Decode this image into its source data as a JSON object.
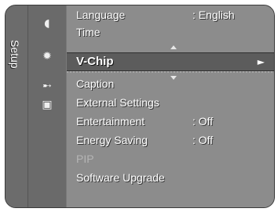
{
  "tab": {
    "label": "Setup"
  },
  "icons": [
    {
      "name": "picture-icon",
      "glyph": "◖"
    },
    {
      "name": "setup-gear-icon",
      "glyph": "✹"
    },
    {
      "name": "input-icon",
      "glyph": "➸"
    },
    {
      "name": "application-icon",
      "glyph": "▣"
    }
  ],
  "menu": {
    "top_items": [
      {
        "label": "Language",
        "value": ": English"
      },
      {
        "label": "Time",
        "value": ""
      }
    ],
    "selected": {
      "label": "V-Chip",
      "arrow": "►"
    },
    "items": [
      {
        "label": "Caption",
        "value": "",
        "disabled": false
      },
      {
        "label": "External Settings",
        "value": "",
        "disabled": false
      },
      {
        "label": "Entertainment",
        "value": ": Off",
        "disabled": false
      },
      {
        "label": "Energy Saving",
        "value": ": Off",
        "disabled": false
      },
      {
        "label": "PIP",
        "value": "",
        "disabled": true
      },
      {
        "label": "Software Upgrade",
        "value": "",
        "disabled": false
      }
    ]
  },
  "colors": {
    "frame": "#3a3a3a",
    "panel": "#8c8c8c",
    "highlight": "#5c5c5c",
    "text": "#ffffff",
    "disabled_text": "#b5b5b5"
  }
}
